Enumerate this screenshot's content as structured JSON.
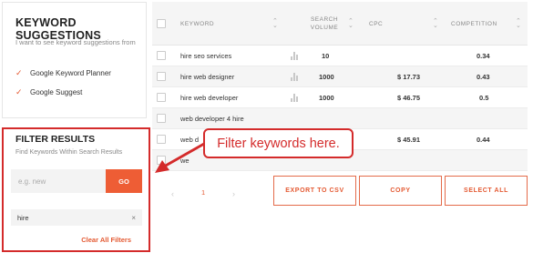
{
  "keyword_suggestions": {
    "title": "KEYWORD SUGGESTIONS",
    "description": "I want to see keyword suggestions from",
    "options": [
      {
        "label": "Google Keyword Planner",
        "checked": true
      },
      {
        "label": "Google Suggest",
        "checked": true
      }
    ]
  },
  "filter": {
    "title": "FILTER RESULTS",
    "description": "Find Keywords Within Search Results",
    "input_placeholder": "e.g. new",
    "go_label": "GO",
    "active_tag": "hire",
    "remove_icon": "×",
    "clear_label": "Clear All Filters"
  },
  "table": {
    "headers": {
      "keyword": "KEYWORD",
      "search_volume_line1": "SEARCH",
      "search_volume_line2": "VOLUME",
      "cpc": "CPC",
      "competition": "COMPETITION"
    },
    "rows": [
      {
        "keyword": "hire seo services",
        "volume": "10",
        "cpc": "",
        "competition": "0.34"
      },
      {
        "keyword": "hire web designer",
        "volume": "1000",
        "cpc": "$ 17.73",
        "competition": "0.43"
      },
      {
        "keyword": "hire web developer",
        "volume": "1000",
        "cpc": "$ 46.75",
        "competition": "0.5"
      },
      {
        "keyword": "web developer 4 hire",
        "volume": "",
        "cpc": "",
        "competition": ""
      },
      {
        "keyword": "web d",
        "volume": "",
        "cpc": "$ 45.91",
        "competition": "0.44"
      },
      {
        "keyword": "we",
        "volume": "",
        "cpc": "",
        "competition": ""
      }
    ]
  },
  "pagination": {
    "prev": "‹",
    "current": "1",
    "next": "›"
  },
  "actions": {
    "export_csv": "EXPORT TO CSV",
    "copy": "COPY",
    "select_all": "SELECT ALL"
  },
  "annotation": {
    "callout_text": "Filter keywords here."
  },
  "colors": {
    "accent": "#ee5d35",
    "annotation_red": "#d42b2b"
  }
}
